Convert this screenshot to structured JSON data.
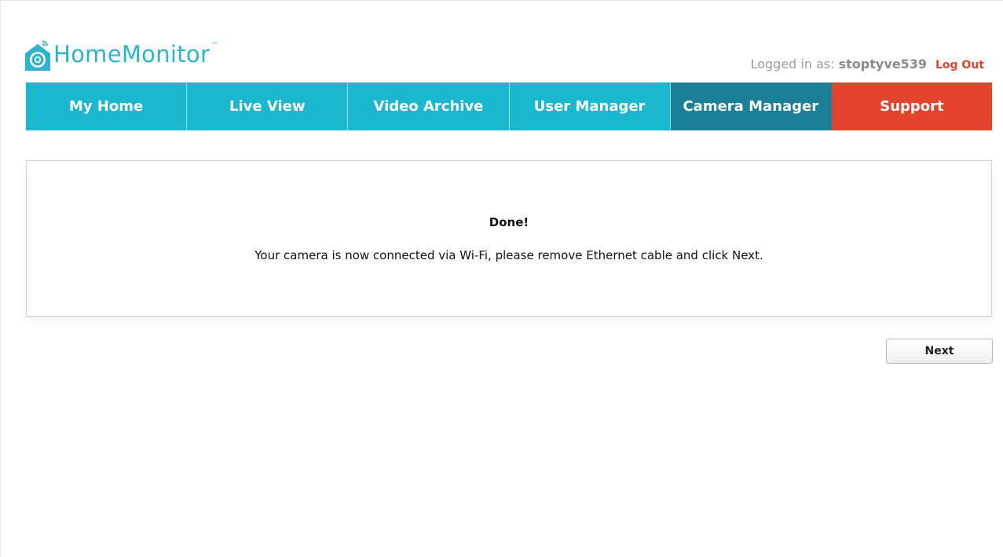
{
  "brand": {
    "name": "HomeMonitor",
    "trademark": "™",
    "color": "#2fb3cd"
  },
  "account": {
    "prefix": "Logged in as:",
    "username": "stoptyve539",
    "logout_label": "Log Out"
  },
  "nav": {
    "items": [
      {
        "label": "My Home",
        "state": "default"
      },
      {
        "label": "Live View",
        "state": "default"
      },
      {
        "label": "Video Archive",
        "state": "default"
      },
      {
        "label": "User Manager",
        "state": "default"
      },
      {
        "label": "Camera Manager",
        "state": "active"
      },
      {
        "label": "Support",
        "state": "highlight"
      }
    ],
    "colors": {
      "default": "#1ab7cf",
      "active": "#1b7f97",
      "support": "#e4432e"
    }
  },
  "panel": {
    "title": "Done!",
    "message": "Your camera is now connected via Wi-Fi, please remove Ethernet cable and click Next."
  },
  "actions": {
    "next_label": "Next"
  },
  "icons": {
    "logo": "house-camera-wifi-icon"
  }
}
